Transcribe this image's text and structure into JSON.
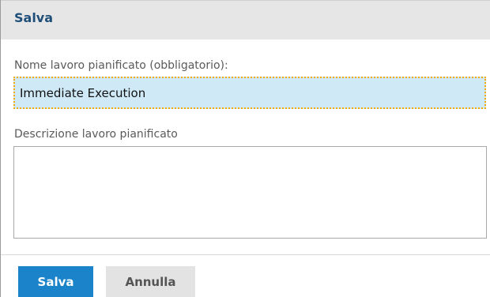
{
  "dialog": {
    "title": "Salva",
    "name_field": {
      "label": "Nome lavoro pianificato (obbligatorio):",
      "value": "Immediate Execution"
    },
    "description_field": {
      "label": "Descrizione lavoro pianificato",
      "value": ""
    },
    "buttons": {
      "save_label": "Salva",
      "cancel_label": "Annulla"
    }
  },
  "colors": {
    "title_text": "#1f4f78",
    "title_bar_bg": "#e6e6e6",
    "input_focus_bg": "#cfe9f6",
    "input_focus_border": "#f2a900",
    "primary_button": "#1b83c9",
    "secondary_button": "#e3e3e3"
  }
}
